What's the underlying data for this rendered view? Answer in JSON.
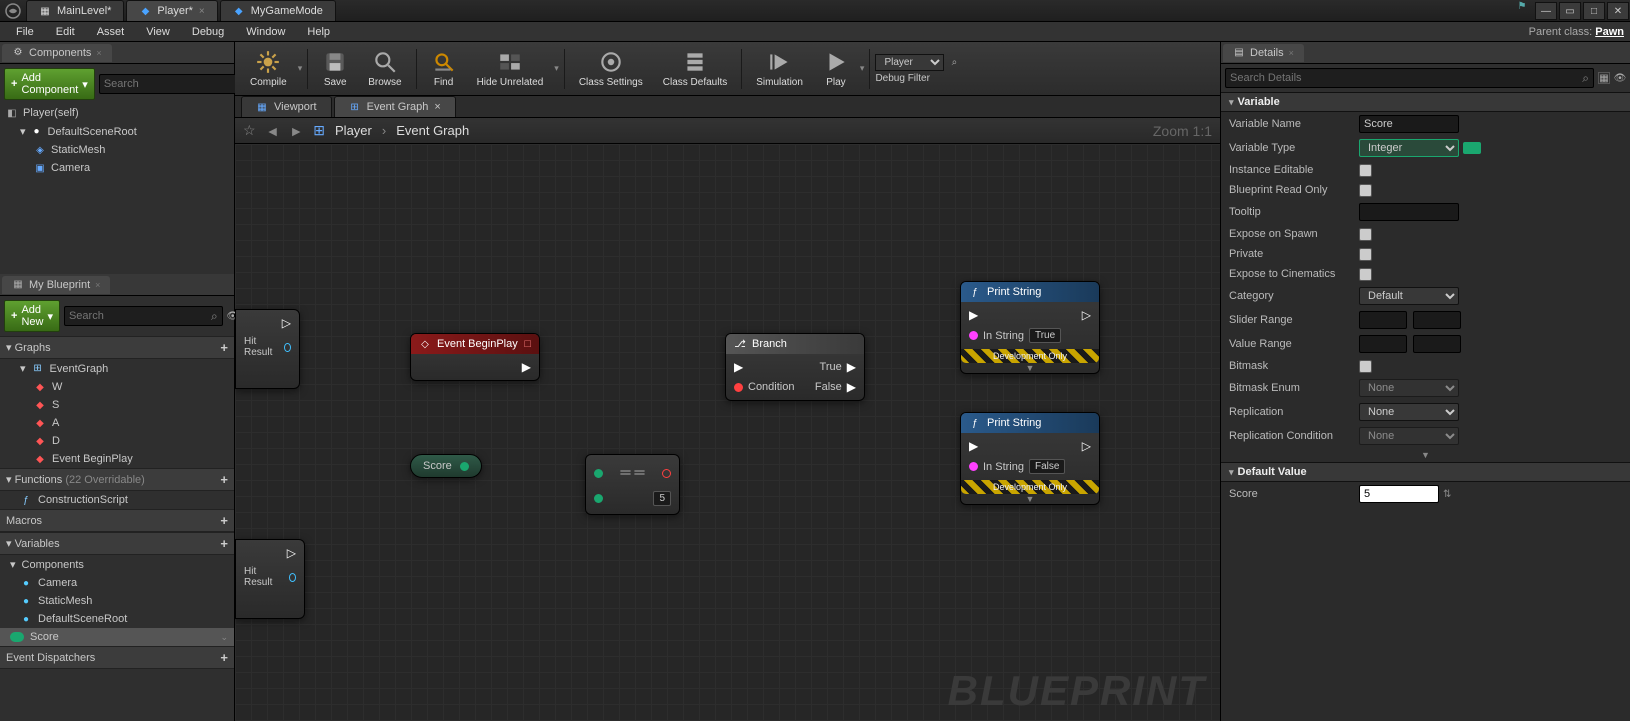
{
  "titlebar": {
    "tabs": [
      {
        "label": "MainLevel*",
        "icon": "level-icon"
      },
      {
        "label": "Player*",
        "icon": "blueprint-icon",
        "active": true
      },
      {
        "label": "MyGameMode",
        "icon": "blueprint-icon"
      }
    ],
    "parent_class_label": "Parent class:",
    "parent_class_value": "Pawn"
  },
  "menubar": [
    "File",
    "Edit",
    "Asset",
    "View",
    "Debug",
    "Window",
    "Help"
  ],
  "toolbar": {
    "compile": "Compile",
    "save": "Save",
    "browse": "Browse",
    "find": "Find",
    "hide_unrelated": "Hide Unrelated",
    "class_settings": "Class Settings",
    "class_defaults": "Class Defaults",
    "simulation": "Simulation",
    "play": "Play",
    "debug_filter_label": "Debug Filter",
    "debug_current": "Player"
  },
  "left": {
    "components_title": "Components",
    "add_component": "Add Component",
    "search_placeholder": "Search",
    "component_root": "Player(self)",
    "component_tree": [
      "DefaultSceneRoot",
      "StaticMesh",
      "Camera"
    ],
    "myblueprint_title": "My Blueprint",
    "add_new": "Add New",
    "graphs_label": "Graphs",
    "eventgraph_label": "EventGraph",
    "graph_items": [
      "W",
      "S",
      "A",
      "D",
      "Event BeginPlay"
    ],
    "functions_label": "Functions",
    "functions_count": "(22 Overridable)",
    "construction_script": "ConstructionScript",
    "macros_label": "Macros",
    "variables_label": "Variables",
    "components_section": "Components",
    "variable_components": [
      "Camera",
      "StaticMesh",
      "DefaultSceneRoot"
    ],
    "variable_score": "Score",
    "event_dispatchers": "Event Dispatchers"
  },
  "center": {
    "viewport_tab": "Viewport",
    "eventgraph_tab": "Event Graph",
    "crumb_player": "Player",
    "crumb_graph": "Event Graph",
    "zoom": "Zoom 1:1",
    "watermark": "BLUEPRINT",
    "nodes": {
      "hit_result1": "Hit Result",
      "hit_result2": "Hit Result",
      "event_beginplay": "Event BeginPlay",
      "score_var": "Score",
      "score_literal": "5",
      "branch": "Branch",
      "branch_cond": "Condition",
      "branch_true": "True",
      "branch_false": "False",
      "print_string": "Print String",
      "in_string": "In String",
      "true_literal": "True",
      "false_literal": "False",
      "dev_only": "Development Only"
    }
  },
  "details": {
    "title": "Details",
    "search_placeholder": "Search Details",
    "section_variable": "Variable",
    "rows": {
      "var_name_label": "Variable Name",
      "var_name_value": "Score",
      "var_type_label": "Variable Type",
      "var_type_value": "Integer",
      "instance_editable": "Instance Editable",
      "bp_readonly": "Blueprint Read Only",
      "tooltip": "Tooltip",
      "expose_spawn": "Expose on Spawn",
      "private": "Private",
      "expose_cine": "Expose to Cinematics",
      "category_label": "Category",
      "category_value": "Default",
      "slider_range": "Slider Range",
      "value_range": "Value Range",
      "bitmask": "Bitmask",
      "bitmask_enum_label": "Bitmask Enum",
      "bitmask_enum_value": "None",
      "replication_label": "Replication",
      "replication_value": "None",
      "replication_cond_label": "Replication Condition",
      "replication_cond_value": "None"
    },
    "section_default": "Default Value",
    "default_score_label": "Score",
    "default_score_value": "5"
  }
}
